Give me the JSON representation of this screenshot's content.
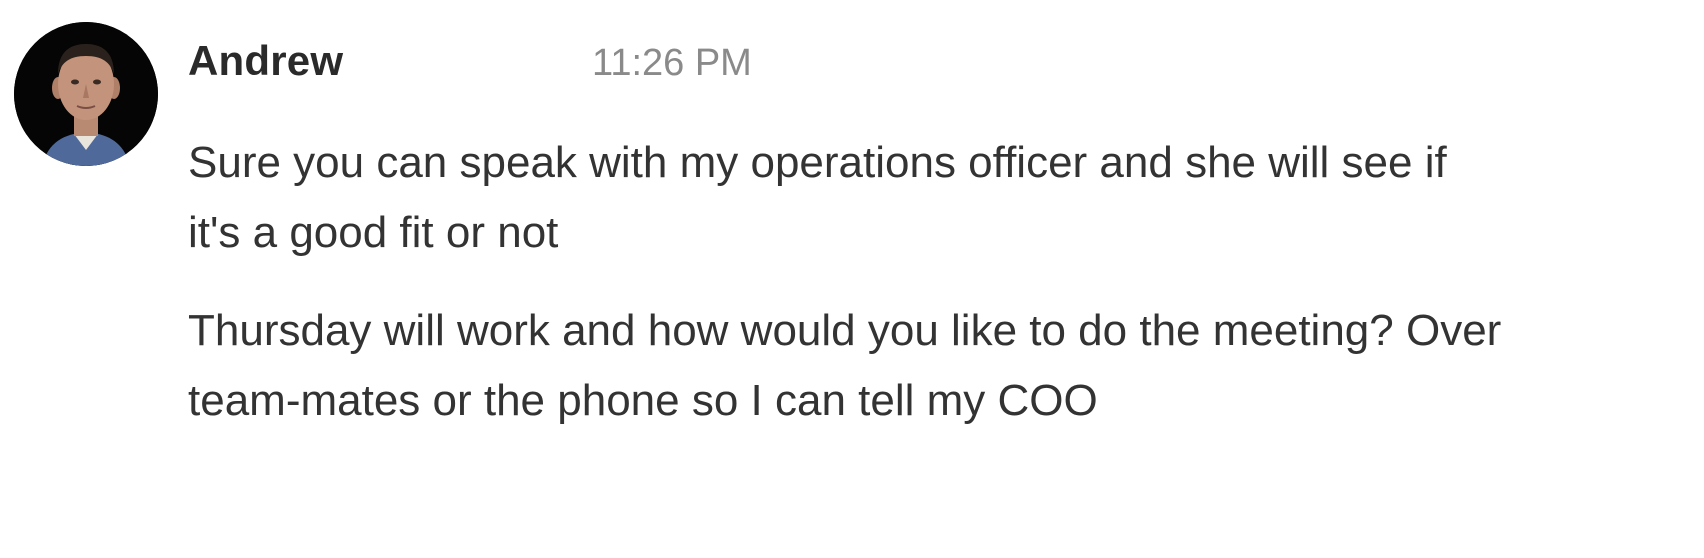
{
  "message": {
    "sender": "Andrew",
    "timestamp": "11:26 PM",
    "avatar_icon": "user-avatar-photo",
    "paragraphs": [
      "Sure you can speak with my operations officer and she will see if it's a good fit or not",
      "Thursday will work and how would you like to do the meeting? Over team-mates or the phone so I can tell my COO"
    ]
  }
}
